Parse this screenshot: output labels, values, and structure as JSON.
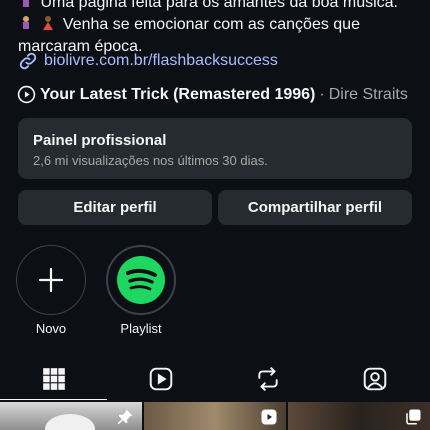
{
  "bio": {
    "line1": "Uma página feita para os amantes da boa música.",
    "line2": "Venha se emocionar com as canções que",
    "line3": "marcaram época."
  },
  "link": {
    "text": "biolivre.com.br/flashbacksuccess"
  },
  "music": {
    "song": "Your Latest Trick (Remastered 1996)",
    "separator": " · ",
    "artist": "Dire Straits"
  },
  "panel": {
    "title": "Painel profissional",
    "subtitle": "2,6 mi visualizações nos últimos 30 dias."
  },
  "buttons": {
    "edit": "Editar perfil",
    "share": "Compartilhar perfil"
  },
  "highlights": [
    {
      "label": "Novo",
      "icon": "plus-icon"
    },
    {
      "label": "Playlist",
      "icon": "spotify-icon"
    }
  ],
  "tabs": [
    {
      "icon": "grid-icon",
      "active": true
    },
    {
      "icon": "reels-icon",
      "active": false
    },
    {
      "icon": "repost-icon",
      "active": false
    },
    {
      "icon": "tagged-icon",
      "active": false
    }
  ],
  "colors": {
    "background": "#0c0f14",
    "card": "#262a31",
    "link": "#a9bdff",
    "spotify": "#1ed760",
    "muted": "#a8a8a8"
  }
}
